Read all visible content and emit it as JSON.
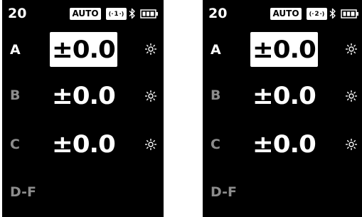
{
  "colors": {
    "background": "#000000",
    "foreground": "#ffffff",
    "inactive_label": "#8c8c8c"
  },
  "screens": [
    {
      "channel": "20",
      "mode_badge": "AUTO",
      "group_number": "1",
      "bluetooth_icon": "bluetooth-icon",
      "battery_icon": "battery-icon",
      "rows": [
        {
          "label": "A",
          "value": "±0.0",
          "selected": true,
          "label_active": true,
          "icon": "light-icon"
        },
        {
          "label": "B",
          "value": "±0.0",
          "selected": false,
          "label_active": false,
          "icon": "light-icon"
        },
        {
          "label": "C",
          "value": "±0.0",
          "selected": false,
          "label_active": false,
          "icon": "light-icon"
        },
        {
          "label": "D-F",
          "value": "",
          "selected": false,
          "label_active": false,
          "icon": ""
        }
      ]
    },
    {
      "channel": "20",
      "mode_badge": "AUTO",
      "group_number": "2",
      "bluetooth_icon": "bluetooth-icon",
      "battery_icon": "battery-icon",
      "rows": [
        {
          "label": "A",
          "value": "±0.0",
          "selected": true,
          "label_active": true,
          "icon": "light-icon"
        },
        {
          "label": "B",
          "value": "±0.0",
          "selected": false,
          "label_active": false,
          "icon": "light-icon"
        },
        {
          "label": "C",
          "value": "±0.0",
          "selected": false,
          "label_active": false,
          "icon": "light-icon"
        },
        {
          "label": "D-F",
          "value": "",
          "selected": false,
          "label_active": false,
          "icon": ""
        }
      ]
    }
  ]
}
